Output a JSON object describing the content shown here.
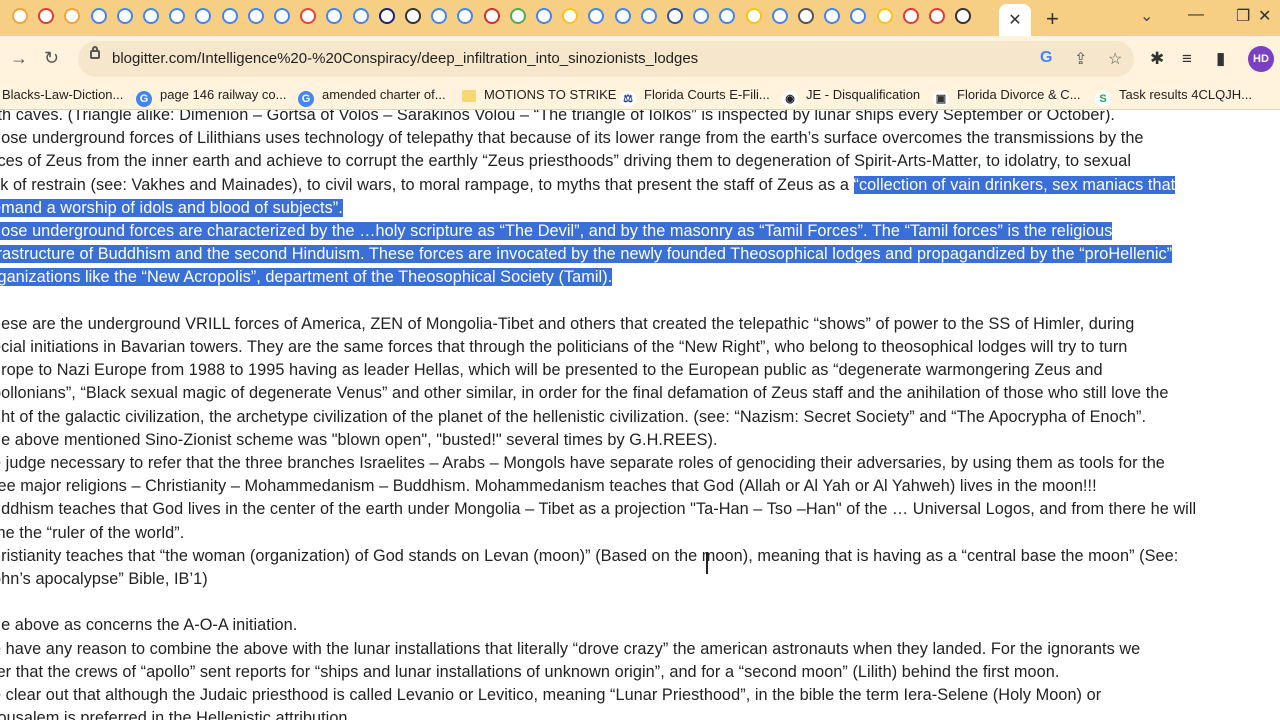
{
  "browser": {
    "url": "blogitter.com/Intelligence%20-%20Conspiracy/deep_infiltration_into_sinozionists_lodges",
    "profile_initials": "HD",
    "close_tab_symbol": "✕",
    "new_tab_symbol": "+",
    "tab_list_symbol": "⌄",
    "colors": {
      "tabstrip": "#f7cf84",
      "toolbar": "#fff3dd",
      "selection": "#3b6fd8",
      "avatar": "#7b3fc4"
    }
  },
  "window_controls": {
    "minimize": "—",
    "restore": "❐",
    "close": "✕"
  },
  "bookmarks": [
    {
      "label": "Blacks-Law-Diction...",
      "icon": ""
    },
    {
      "label": "page 146 railway co...",
      "icon": "google-icon"
    },
    {
      "label": "amended charter of...",
      "icon": "google-icon"
    },
    {
      "label": "MOTIONS TO STRIKE",
      "icon": "folder-icon"
    },
    {
      "label": "Florida Courts E-Fili...",
      "icon": "courts-icon"
    },
    {
      "label": "JE - Disqualification",
      "icon": "je-icon"
    },
    {
      "label": "Florida Divorce & C...",
      "icon": "box-icon"
    },
    {
      "label": "Task results 4CLQJH...",
      "icon": "task-icon"
    }
  ],
  "document": {
    "lines": [
      {
        "text": "rth caves. (Triangle alike: Dimenion – Gortsa of Volos – Sarakinos Volou – “The triangle of Iolkos” is inspected by lunar ships every September or October).",
        "selected_from": null
      },
      {
        "text": "hose underground forces of Lilithians uses technology of telepathy that because of its lower range from the earth’s surface overcomes the transmissions by the",
        "selected_from": null
      },
      {
        "text": "rces of Zeus from the inner earth and achieve to corrupt the earthly “Zeus priesthoods” driving them to degeneration of Spirit-Arts-Matter, to idolatry, to sexual",
        "selected_from": null
      },
      {
        "text": "ck of restrain (see: Vakhes and Mainades), to civil wars, to moral rampage, to myths that present the staff of Zeus as a ",
        "selected_text": "“collection of vain drinkers, sex maniacs that",
        "selected_from": "partial"
      },
      {
        "text": "",
        "selected_text": "emand a worship of idols and blood of subjects”.",
        "selected_from": "full"
      },
      {
        "text": "",
        "selected_text": "hose underground forces are characterized by the …holy scripture as “The Devil”, and by the masonry as “Tamil Forces”. The “Tamil forces” is the religious",
        "selected_from": "full"
      },
      {
        "text": "",
        "selected_text": "frastructure of Buddhism and the second Hinduism. These forces are invocated by the newly founded Theosophical lodges and propagandized by the “proHellenic”",
        "selected_from": "full"
      },
      {
        "text": "",
        "selected_text": "rganizations like the “New Acropolis”, department of the Theosophical Society (Tamil).",
        "selected_from": "full"
      },
      {
        "text": "",
        "selected_from": null
      },
      {
        "text": "hese are the underground VRILL forces of America, ZEN of Mongolia-Tibet and others that created the telepathic “shows” of power to the SS of Himler, during",
        "selected_from": null
      },
      {
        "text": "ecial initiations in Bavarian towers. They are the same forces that through the politicians of the “New Right”, who belong to theosophical lodges will try to turn",
        "selected_from": null
      },
      {
        "text": "urope to Nazi Europe from 1988 to 1995 having as leader Hellas, which will be presented to the European public as “degenerate warmongering Zeus and",
        "selected_from": null
      },
      {
        "text": "pollonians”, “Black sexual magic of degenerate Venus” and other similar, in order for the final defamation of Zeus staff and the anihilation of those who still love the",
        "selected_from": null
      },
      {
        "text": "ght of the galactic civilization, the archetype civilization of the planet of the hellenistic civilization. (see: “Nazism: Secret Society” and “The Apocrypha of Enoch”.",
        "selected_from": null
      },
      {
        "text": "he above mentioned Sino-Zionist scheme was \"blown open\", \"busted!\" several times by G.H.REES).",
        "selected_from": null
      },
      {
        "text": "e judge necessary to refer that the three branches Israelites – Arabs – Mongols have separate roles of genociding their adversaries, by using them as tools for the",
        "selected_from": null
      },
      {
        "text": "ree major religions – Christianity – Mohammedanism – Buddhism. Mohammedanism teaches that God (Allah or Al Yah or Al Yahweh) lives in the moon!!!",
        "selected_from": null
      },
      {
        "text": "uddhism teaches that God lives in the center of the earth under Mongolia – Tibet as a projection \"Ta-Han – Tso –Han\" of the … Universal Logos, and from there he will",
        "selected_from": null
      },
      {
        "text": "me the “ruler of the world”.",
        "selected_from": null
      },
      {
        "text": "hristianity teaches that “the woman (organization) of God stands on Levan (moon)” (Based on the moon), meaning that is having as a “central base the moon” (See:",
        "selected_from": null
      },
      {
        "text": "ohn’s apocalypse” Bible, IB’1)",
        "selected_from": null
      },
      {
        "text": "",
        "selected_from": null
      },
      {
        "text": "he above as concerns the A-O-A initiation.",
        "selected_from": null
      },
      {
        "text": "e have any reason to combine the above with the lunar installations that literally “drove crazy” the american astronauts when they landed. For the ignorants we",
        "selected_from": null
      },
      {
        "text": "fer that the crews of “apollo” sent reports for “ships and lunar installations of unknown origin”, and for a “second moon” (Lilith) behind the first moon.",
        "selected_from": null
      },
      {
        "text": "e clear out that although the Judaic priesthood is called Levanio or Levitico, meaning “Lunar Priesthood”, in the bible the term Iera-Selene (Holy Moon) or",
        "selected_from": null
      },
      {
        "text": "rousalem is preferred in the Hellenistic attribution",
        "selected_from": null
      }
    ]
  }
}
